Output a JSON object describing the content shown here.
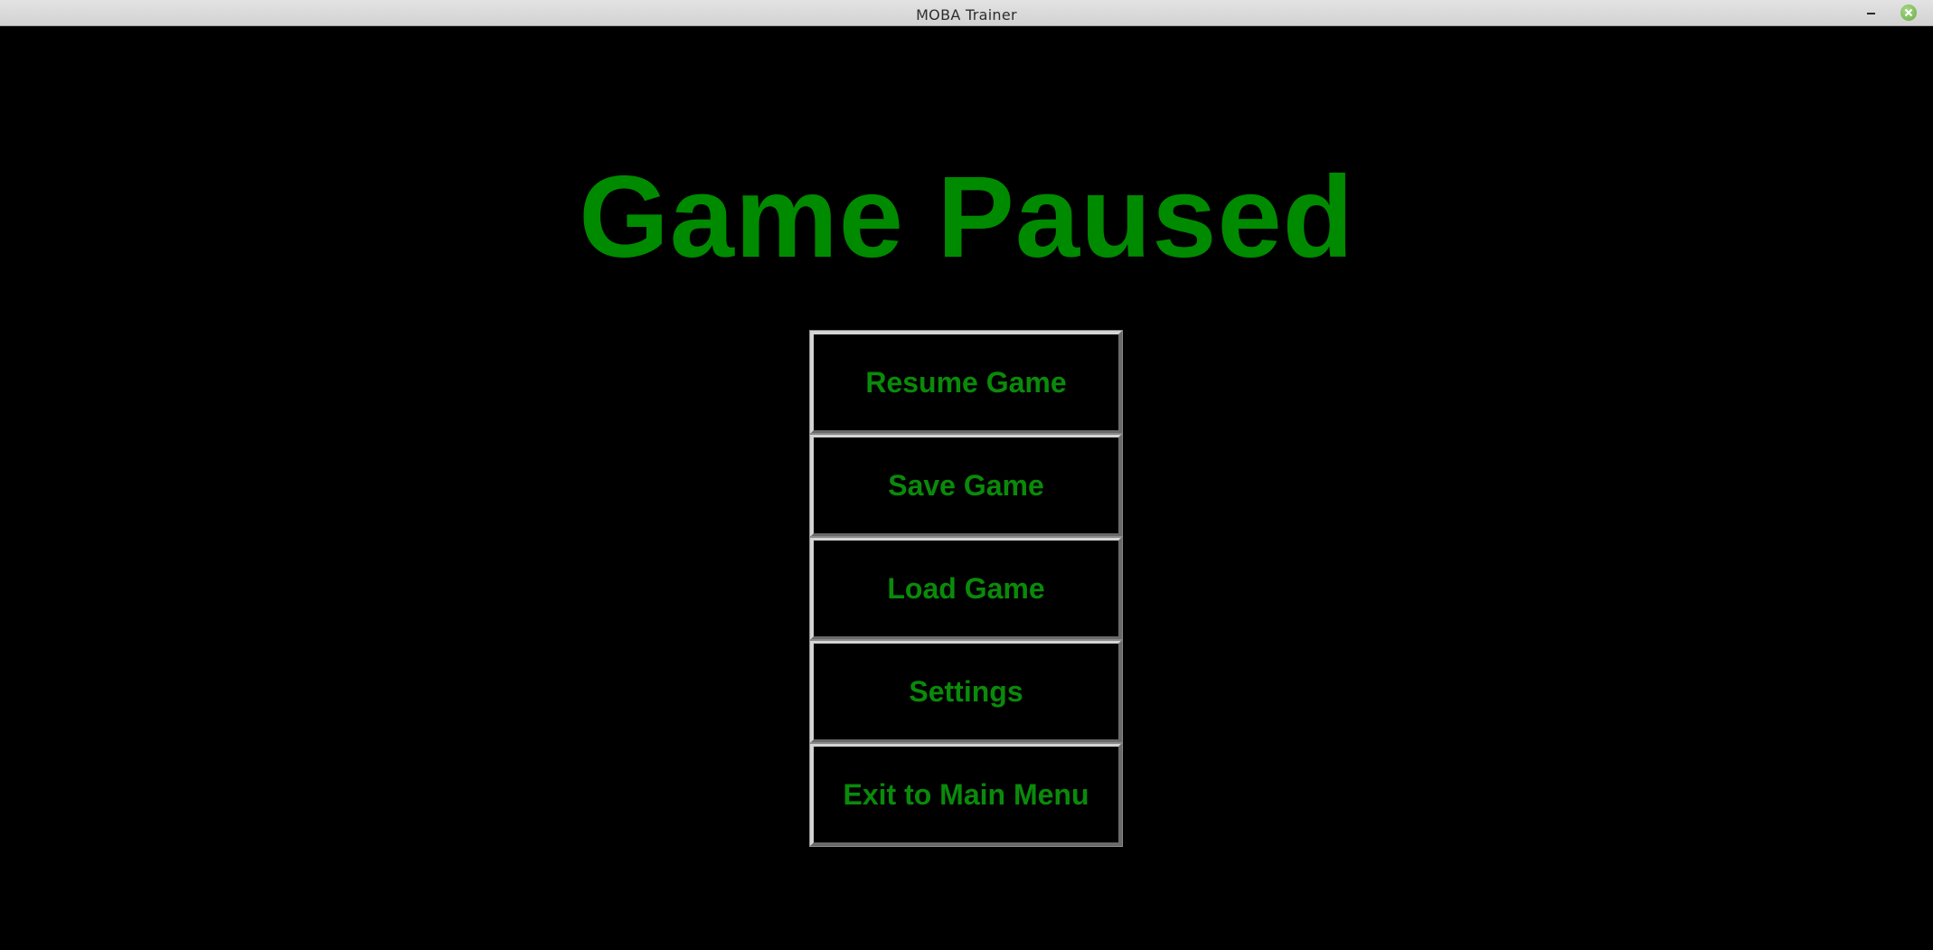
{
  "window": {
    "title": "MOBA Trainer"
  },
  "pause_menu": {
    "heading": "Game Paused",
    "buttons": [
      {
        "label": "Resume Game"
      },
      {
        "label": "Save Game"
      },
      {
        "label": "Load Game"
      },
      {
        "label": "Settings"
      },
      {
        "label": "Exit to Main Menu"
      }
    ]
  },
  "colors": {
    "background": "#000000",
    "accent_green": "#008a00",
    "titlebar": "#dcdcdc",
    "close_button": "#7cb956"
  },
  "icons": {
    "minimize": "minimize-icon",
    "close": "close-icon"
  }
}
